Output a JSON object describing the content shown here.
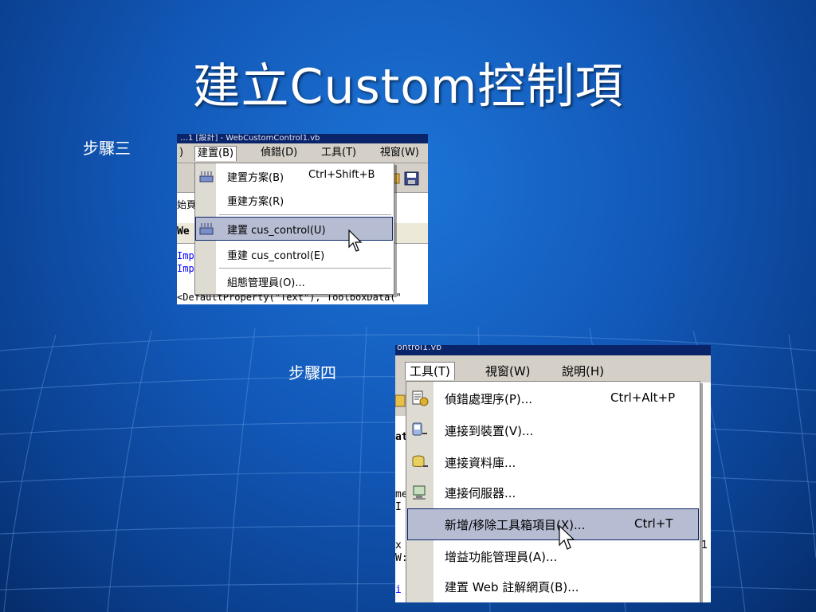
{
  "slide": {
    "title": "建立Custom控制項",
    "step3_label": "步驟三",
    "step4_label": "步驟四"
  },
  "colors": {
    "background": "#1258b8",
    "title_text": "#ffffff",
    "menu_highlight": "#b6bdd2",
    "highlight_border": "#0a246a",
    "menu_bg": "#d4d0c8"
  },
  "shot1": {
    "titlebar_text": "…1 [設計] - WebCustomControl1.vb",
    "menubar": [
      {
        "label": "建置(B)",
        "open": true
      },
      {
        "label": "偵錯(D)",
        "open": false
      },
      {
        "label": "工具(T)",
        "open": false
      },
      {
        "label": "視窗(W)",
        "open": false
      }
    ],
    "menubar_prefix": ")",
    "tab_text": "We",
    "left_peek": [
      "始頁"
    ],
    "code_lines": [
      "Imp",
      "Imp"
    ],
    "bottom_code": "<DefaultProperty(\"Text\"), ToolboxData(\"",
    "menu_items": [
      {
        "label": "建置方案(B)",
        "shortcut": "Ctrl+Shift+B",
        "icon": "build-solution-icon",
        "highlighted": false
      },
      {
        "label": "重建方案(R)",
        "shortcut": "",
        "icon": "",
        "highlighted": false
      },
      {
        "label": "建置 cus_control(U)",
        "shortcut": "",
        "icon": "build-project-icon",
        "highlighted": true
      },
      {
        "label": "重建 cus_control(E)",
        "shortcut": "",
        "icon": "",
        "highlighted": false
      },
      {
        "label": "組態管理員(O)...",
        "shortcut": "",
        "icon": "",
        "highlighted": false
      }
    ]
  },
  "shot2": {
    "titlebar_text": "ontrol1.vb",
    "menubar": [
      {
        "label": "工具(T)",
        "open": true
      },
      {
        "label": "視窗(W)",
        "open": false
      },
      {
        "label": "說明(H)",
        "open": false
      }
    ],
    "left_peek": [
      "at",
      "me",
      "I",
      "x",
      "W:",
      "i"
    ],
    "right_peek": [
      "1"
    ],
    "menu_items": [
      {
        "label": "偵錯處理序(P)...",
        "shortcut": "Ctrl+Alt+P",
        "icon": "debug-process-icon",
        "highlighted": false
      },
      {
        "label": "連接到裝置(V)...",
        "shortcut": "",
        "icon": "connect-device-icon",
        "highlighted": false
      },
      {
        "label": "連接資料庫...",
        "shortcut": "",
        "icon": "connect-database-icon",
        "highlighted": false
      },
      {
        "label": "連接伺服器...",
        "shortcut": "",
        "icon": "connect-server-icon",
        "highlighted": false
      },
      {
        "label": "新增/移除工具箱項目(X)...",
        "shortcut": "Ctrl+T",
        "icon": "",
        "highlighted": true
      },
      {
        "label": "增益功能管理員(A)...",
        "shortcut": "",
        "icon": "",
        "highlighted": false
      },
      {
        "label": "建置 Web 註解網頁(B)...",
        "shortcut": "",
        "icon": "",
        "highlighted": false
      }
    ]
  }
}
